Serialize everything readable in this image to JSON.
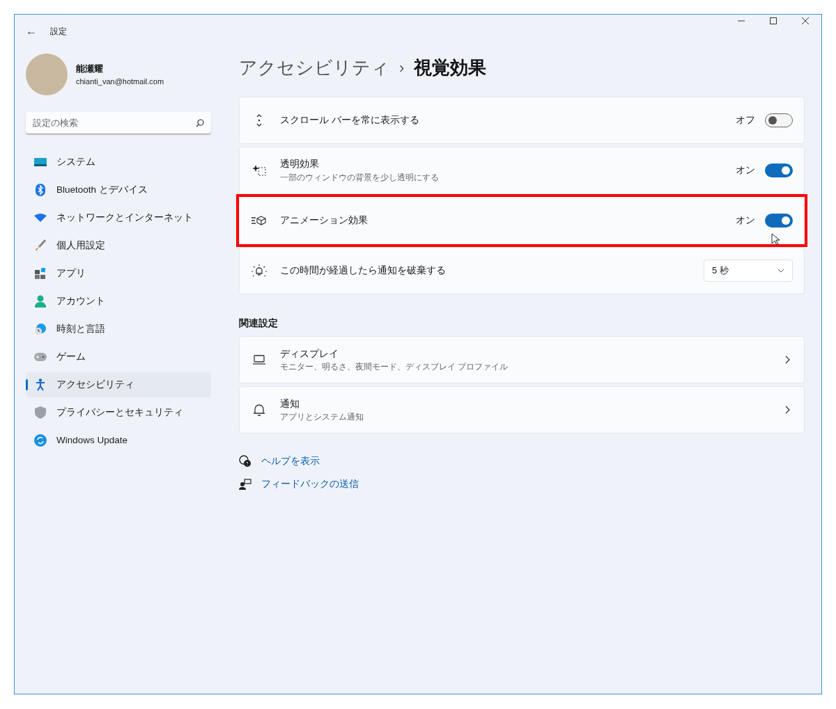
{
  "window": {
    "title": "設定",
    "back": "←"
  },
  "profile": {
    "name": "能瀬耀",
    "email": "chianti_van@hotmail.com"
  },
  "search": {
    "placeholder": "設定の検索"
  },
  "sidebar": {
    "items": [
      {
        "label": "システム",
        "selected": false
      },
      {
        "label": "Bluetooth とデバイス",
        "selected": false
      },
      {
        "label": "ネットワークとインターネット",
        "selected": false
      },
      {
        "label": "個人用設定",
        "selected": false
      },
      {
        "label": "アプリ",
        "selected": false
      },
      {
        "label": "アカウント",
        "selected": false
      },
      {
        "label": "時刻と言語",
        "selected": false
      },
      {
        "label": "ゲーム",
        "selected": false
      },
      {
        "label": "アクセシビリティ",
        "selected": true
      },
      {
        "label": "プライバシーとセキュリティ",
        "selected": false
      },
      {
        "label": "Windows Update",
        "selected": false
      }
    ]
  },
  "breadcrumb": {
    "parent": "アクセシビリティ",
    "separator": "›",
    "current": "視覚効果"
  },
  "settings": [
    {
      "kind": "toggle",
      "title": "スクロール バーを常に表示する",
      "state_label": "オフ",
      "on": false,
      "highlighted": false
    },
    {
      "kind": "toggle",
      "title": "透明効果",
      "description": "一部のウィンドウの背景を少し透明にする",
      "state_label": "オン",
      "on": true,
      "highlighted": false
    },
    {
      "kind": "toggle",
      "title": "アニメーション効果",
      "state_label": "オン",
      "on": true,
      "highlighted": true
    },
    {
      "kind": "select",
      "title": "この時間が経過したら通知を破棄する",
      "value": "5 秒",
      "highlighted": false
    }
  ],
  "related": {
    "heading": "関連設定",
    "items": [
      {
        "title": "ディスプレイ",
        "description": "モニター、明るさ、夜間モード、ディスプレイ プロファイル"
      },
      {
        "title": "通知",
        "description": "アプリとシステム通知"
      }
    ]
  },
  "links": [
    "ヘルプを表示",
    "フィードバックの送信"
  ]
}
